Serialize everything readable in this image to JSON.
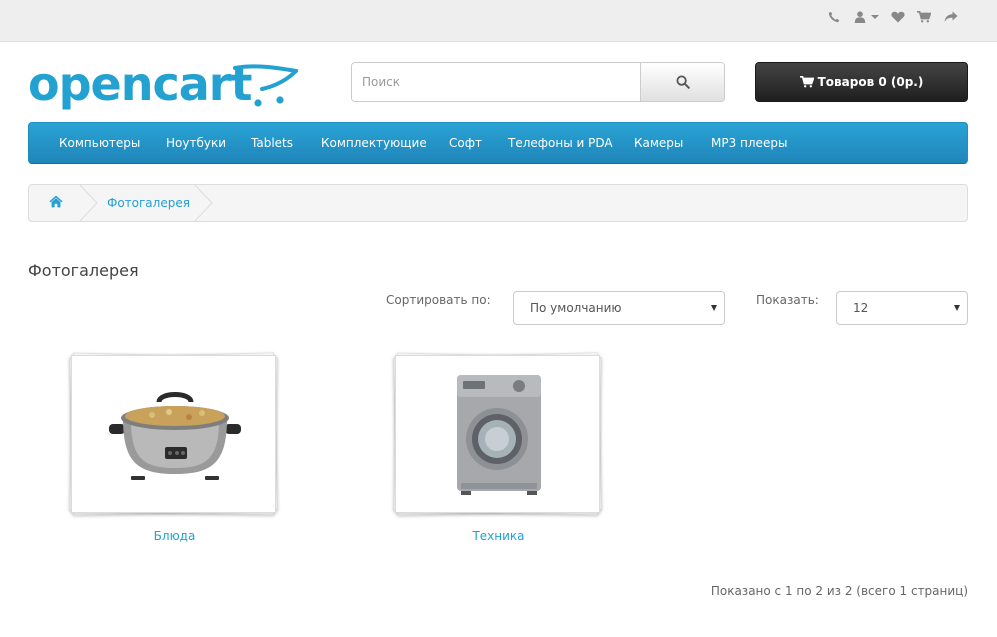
{
  "colors": {
    "accent": "#23a1d1",
    "menu_bg": "#229ac8",
    "cart_bg": "#363636",
    "topbar_bg": "#eeeeee"
  },
  "topbar": {
    "icons": [
      "phone-icon",
      "user-icon",
      "heart-icon",
      "cart-icon",
      "share-icon"
    ]
  },
  "logo": {
    "text": "opencart"
  },
  "search": {
    "placeholder": "Поиск",
    "value": ""
  },
  "cart": {
    "label": "Товаров 0 (0р.)"
  },
  "menu": {
    "items": [
      {
        "label": "Компьютеры"
      },
      {
        "label": "Ноутбуки"
      },
      {
        "label": "Tablets"
      },
      {
        "label": "Комплектующие"
      },
      {
        "label": "Софт"
      },
      {
        "label": "Телефоны и PDA"
      },
      {
        "label": "Камеры"
      },
      {
        "label": "MP3 плееры"
      }
    ]
  },
  "breadcrumb": {
    "items": [
      {
        "label": "Фотогалерея"
      }
    ]
  },
  "page": {
    "title": "Фотогалерея",
    "sort_label": "Сортировать по:",
    "sort_value": "По умолчанию",
    "limit_label": "Показать:",
    "limit_value": "12"
  },
  "gallery": {
    "items": [
      {
        "label": "Блюда",
        "image": "slow-cooker"
      },
      {
        "label": "Техника",
        "image": "washing-machine"
      }
    ]
  },
  "pagination": {
    "info": "Показано с 1 по 2 из 2 (всего 1 страниц)"
  }
}
